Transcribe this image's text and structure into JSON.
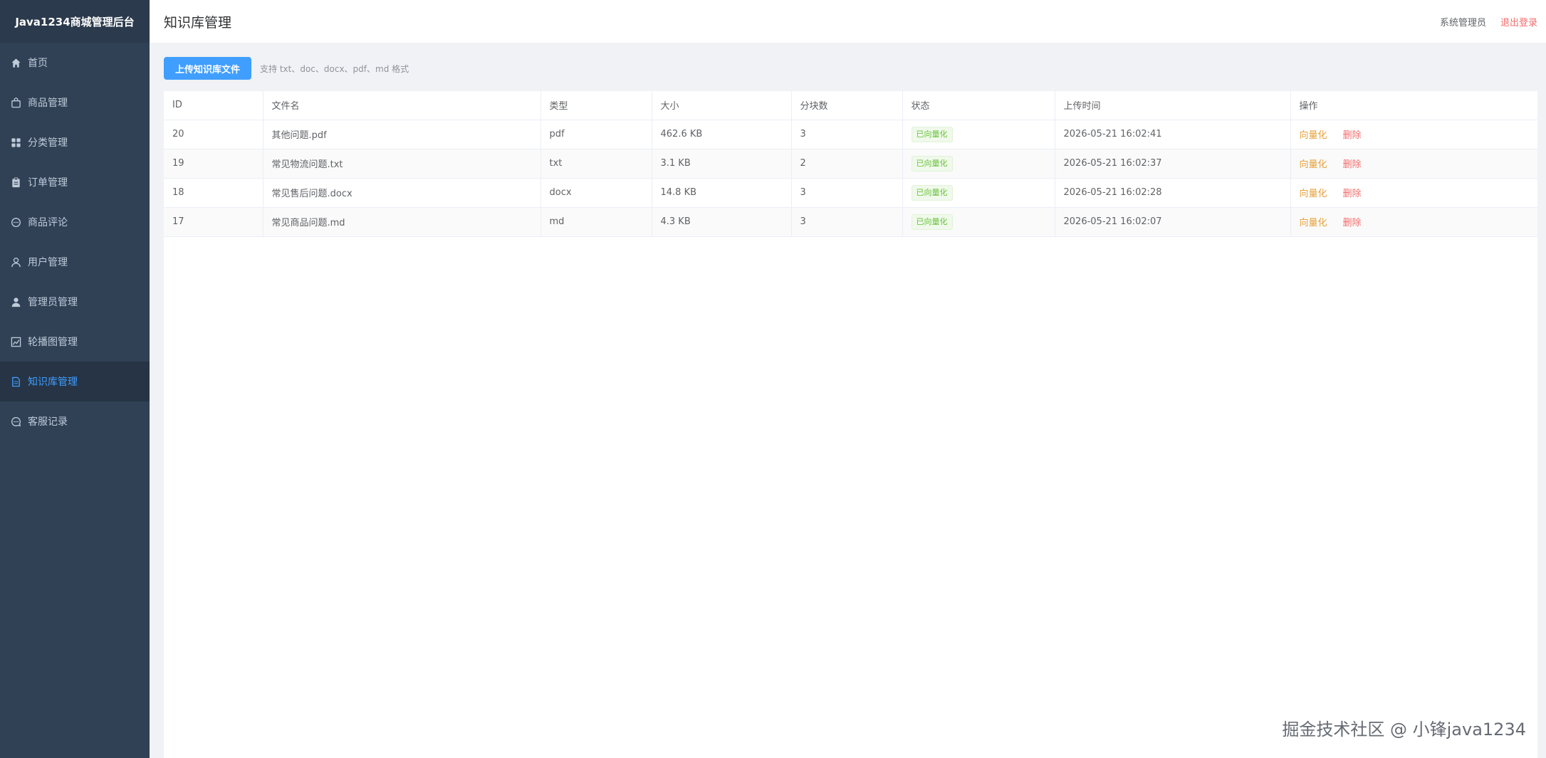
{
  "brand": "Java1234商城管理后台",
  "sidebar": {
    "items": [
      {
        "label": "首页",
        "icon": "home-icon"
      },
      {
        "label": "商品管理",
        "icon": "bag-icon"
      },
      {
        "label": "分类管理",
        "icon": "grid-icon"
      },
      {
        "label": "订单管理",
        "icon": "clipboard-icon"
      },
      {
        "label": "商品评论",
        "icon": "comment-icon"
      },
      {
        "label": "用户管理",
        "icon": "user-icon"
      },
      {
        "label": "管理员管理",
        "icon": "user-filled-icon"
      },
      {
        "label": "轮播图管理",
        "icon": "chart-icon"
      },
      {
        "label": "知识库管理",
        "icon": "document-icon",
        "active": true
      },
      {
        "label": "客服记录",
        "icon": "chat-icon"
      }
    ],
    "active_color": "#409eff"
  },
  "header": {
    "title": "知识库管理",
    "admin_name": "系统管理员",
    "logout_label": "退出登录"
  },
  "toolbar": {
    "upload_label": "上传知识库文件",
    "hint": "支持 txt、doc、docx、pdf、md 格式"
  },
  "table": {
    "headers": [
      "ID",
      "文件名",
      "类型",
      "大小",
      "分块数",
      "状态",
      "上传时间",
      "操作"
    ],
    "rows": [
      {
        "id": "20",
        "name": "其他问题.pdf",
        "type": "pdf",
        "size": "462.6 KB",
        "chunks": "3",
        "status": "已向量化",
        "time": "2026-05-21 16:02:41"
      },
      {
        "id": "19",
        "name": "常见物流问题.txt",
        "type": "txt",
        "size": "3.1 KB",
        "chunks": "2",
        "status": "已向量化",
        "time": "2026-05-21 16:02:37"
      },
      {
        "id": "18",
        "name": "常见售后问题.docx",
        "type": "docx",
        "size": "14.8 KB",
        "chunks": "3",
        "status": "已向量化",
        "time": "2026-05-21 16:02:28"
      },
      {
        "id": "17",
        "name": "常见商品问题.md",
        "type": "md",
        "size": "4.3 KB",
        "chunks": "3",
        "status": "已向量化",
        "time": "2026-05-21 16:02:07"
      }
    ],
    "actions": {
      "vectorize": "向量化",
      "delete": "删除"
    }
  },
  "watermark": "掘金技术社区 @ 小锋java1234"
}
